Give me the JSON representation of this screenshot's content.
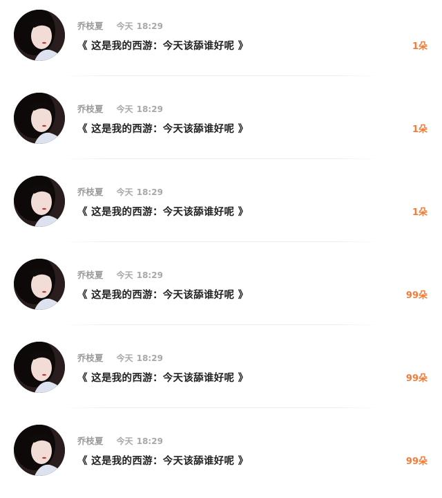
{
  "feed": {
    "items": [
      {
        "author": "乔枝夏",
        "day": "今天",
        "time": "18:29",
        "title": "《 这是我的西游：今天该舔谁好呢 》",
        "flowers": "1朵"
      },
      {
        "author": "乔枝夏",
        "day": "今天",
        "time": "18:29",
        "title": "《 这是我的西游：今天该舔谁好呢 》",
        "flowers": "1朵"
      },
      {
        "author": "乔枝夏",
        "day": "今天",
        "time": "18:29",
        "title": "《 这是我的西游：今天该舔谁好呢 》",
        "flowers": "1朵"
      },
      {
        "author": "乔枝夏",
        "day": "今天",
        "time": "18:29",
        "title": "《 这是我的西游：今天该舔谁好呢 》",
        "flowers": "99朵"
      },
      {
        "author": "乔枝夏",
        "day": "今天",
        "time": "18:29",
        "title": "《 这是我的西游：今天该舔谁好呢 》",
        "flowers": "99朵"
      },
      {
        "author": "乔枝夏",
        "day": "今天",
        "time": "18:29",
        "title": "《 这是我的西游：今天该舔谁好呢 》",
        "flowers": "99朵"
      }
    ],
    "colors": {
      "accent": "#f07c38",
      "author": "#9b9b9b",
      "title": "#222222"
    },
    "icons": {
      "avatar": "user-avatar-portrait"
    }
  }
}
